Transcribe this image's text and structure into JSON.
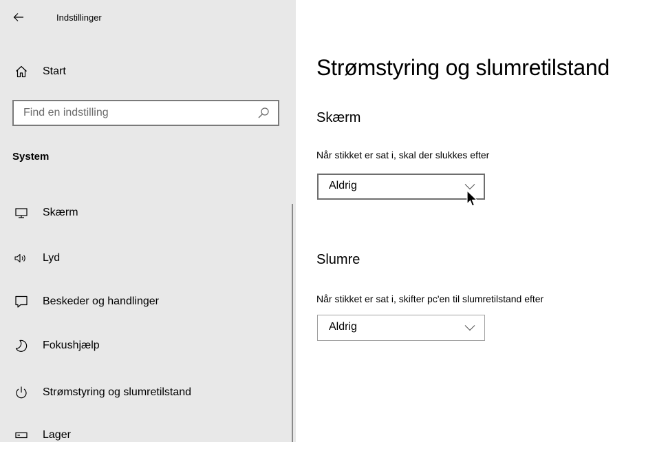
{
  "window": {
    "title": "Indstillinger"
  },
  "sidebar": {
    "home_label": "Start",
    "search": {
      "placeholder": "Find en indstilling",
      "value": ""
    },
    "section_heading": "System",
    "items": [
      {
        "label": "Skærm",
        "icon": "monitor-icon"
      },
      {
        "label": "Lyd",
        "icon": "speaker-icon"
      },
      {
        "label": "Beskeder og handlinger",
        "icon": "message-icon"
      },
      {
        "label": "Fokushjælp",
        "icon": "moon-icon"
      },
      {
        "label": "Strømstyring og slumretilstand",
        "icon": "power-icon"
      },
      {
        "label": "Lager",
        "icon": "storage-icon"
      }
    ]
  },
  "main": {
    "title": "Strømstyring og slumretilstand",
    "screen": {
      "heading": "Skærm",
      "label": "Når stikket er sat i, skal der slukkes efter",
      "value": "Aldrig"
    },
    "sleep": {
      "heading": "Slumre",
      "label": "Når stikket er sat i, skifter pc'en til slumretilstand efter",
      "value": "Aldrig"
    }
  }
}
